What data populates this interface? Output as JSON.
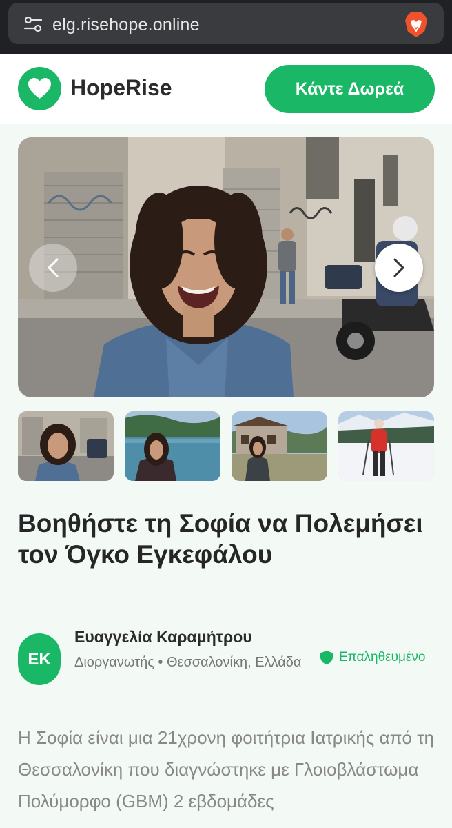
{
  "browser": {
    "url": "elg.risehope.online",
    "icons": [
      "tune-icon",
      "brave-lion-icon"
    ]
  },
  "header": {
    "brand": "HopeRise",
    "donate_label": "Κάντε Δωρεά",
    "logo_icon": "heart-icon"
  },
  "gallery": {
    "prev_icon": "chevron-left-icon",
    "next_icon": "chevron-right-icon",
    "thumbnails": [
      "street-photo",
      "lake-photo",
      "cabin-photo",
      "ski-photo"
    ]
  },
  "campaign": {
    "title": "Βοηθήστε τη Σοφία να Πολεμήσει τον Όγκο Εγκεφάλου",
    "organizer": {
      "initials": "ΕΚ",
      "name": "Ευαγγελία Καραμήτρου",
      "meta": "Διοργανωτής • Θεσσαλονίκη, Ελλάδα",
      "verified_label": "Επαληθευμένο"
    },
    "story": "Η Σοφία είναι μια 21χρονη φοιτήτρια Ιατρικής από τη Θεσσαλονίκη που διαγνώστηκε με Γλοιοβλάστωμα Πολύμορφο (GBM) 2 εβδομάδες"
  },
  "colors": {
    "brand_green": "#1ab866",
    "page_bg": "#f3faf6",
    "browser_bg": "#202124"
  }
}
